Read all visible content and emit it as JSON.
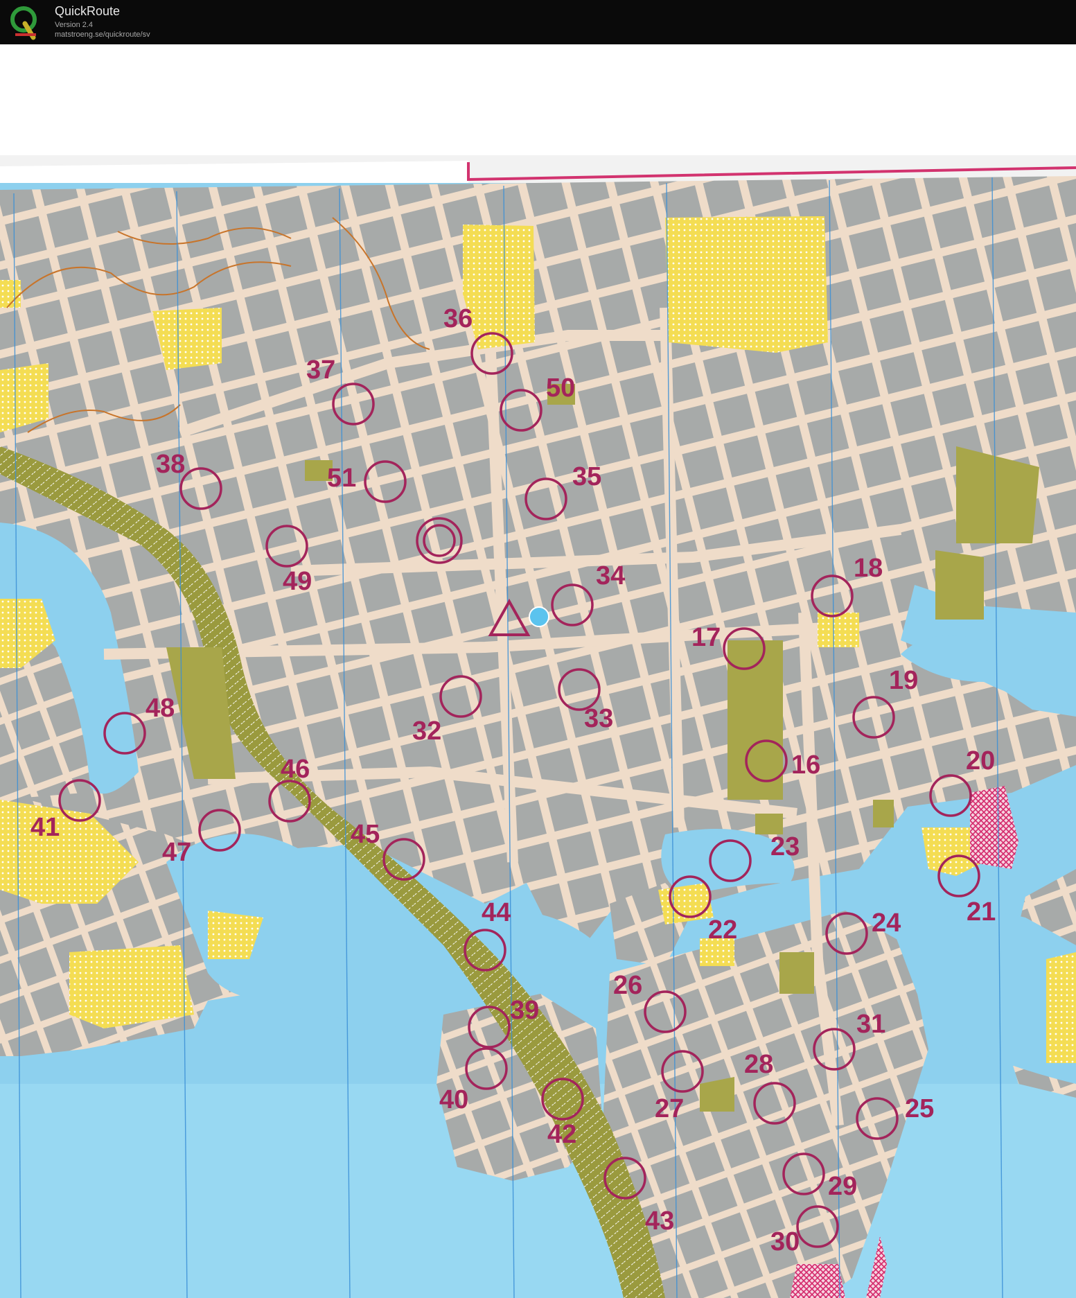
{
  "app": {
    "name": "QuickRoute",
    "version": "Version 2.4",
    "url": "matstroeng.se/quickroute/sv",
    "logo_letter": "Q"
  },
  "map": {
    "colors": {
      "water": "#8dd0ee",
      "water_deep": "#7cc6ec",
      "buildings": "#a7aaa9",
      "streets": "#efdcc9",
      "open_yellow": "#f4dd53",
      "olive": "#a8a64a",
      "contours": "#c8742a",
      "course": "#a3245b",
      "meridian": "#3a8fd6",
      "paper": "#ffffff"
    },
    "start_symbol": "triangle",
    "controls": [
      {
        "number": "16"
      },
      {
        "number": "17"
      },
      {
        "number": "18"
      },
      {
        "number": "19"
      },
      {
        "number": "20"
      },
      {
        "number": "21"
      },
      {
        "number": "22"
      },
      {
        "number": "23"
      },
      {
        "number": "24"
      },
      {
        "number": "25"
      },
      {
        "number": "26"
      },
      {
        "number": "27"
      },
      {
        "number": "28"
      },
      {
        "number": "29"
      },
      {
        "number": "30"
      },
      {
        "number": "31"
      },
      {
        "number": "32"
      },
      {
        "number": "33"
      },
      {
        "number": "34"
      },
      {
        "number": "35"
      },
      {
        "number": "36"
      },
      {
        "number": "37"
      },
      {
        "number": "38"
      },
      {
        "number": "39"
      },
      {
        "number": "40"
      },
      {
        "number": "41"
      },
      {
        "number": "42"
      },
      {
        "number": "43"
      },
      {
        "number": "44"
      },
      {
        "number": "45"
      },
      {
        "number": "46"
      },
      {
        "number": "47"
      },
      {
        "number": "48"
      },
      {
        "number": "49"
      },
      {
        "number": "50"
      },
      {
        "number": "51"
      }
    ]
  }
}
